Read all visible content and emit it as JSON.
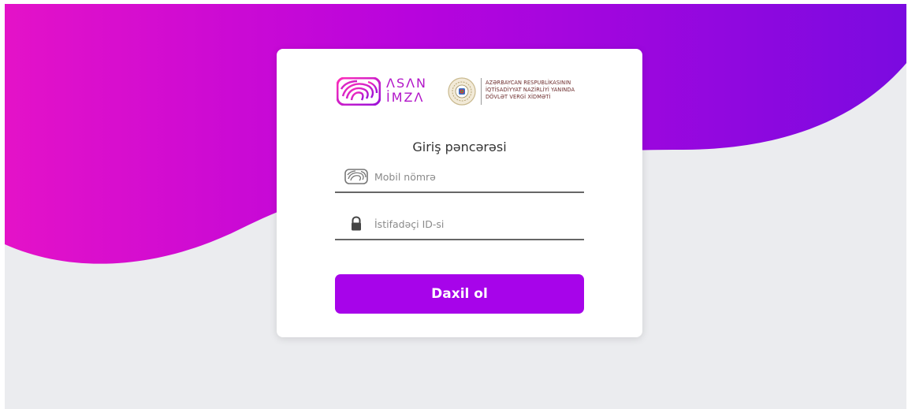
{
  "brand": {
    "asan_line1": "ΛSΛN",
    "asan_line2": "İMZΛ",
    "agency_lines": [
      "AZƏRBAYCAN RESPUBLİKASININ",
      "İQTİSADİYYAT NAZİRLİYİ YANINDA",
      "DÖVLƏT VERGİ XİDMƏTİ"
    ]
  },
  "form": {
    "title": "Giriş pəncərəsi",
    "phone_placeholder": "Mobil nömrə",
    "id_placeholder": "İstifadəçi ID-si",
    "submit_label": "Daxil ol"
  },
  "icons": {
    "phone_field": "asan-fingerprint-icon",
    "id_field": "lock-icon"
  },
  "colors": {
    "accent": "#a704ea",
    "gradient_start": "#e412c8",
    "gradient_end": "#7b0ae0",
    "background": "#ebecef"
  }
}
